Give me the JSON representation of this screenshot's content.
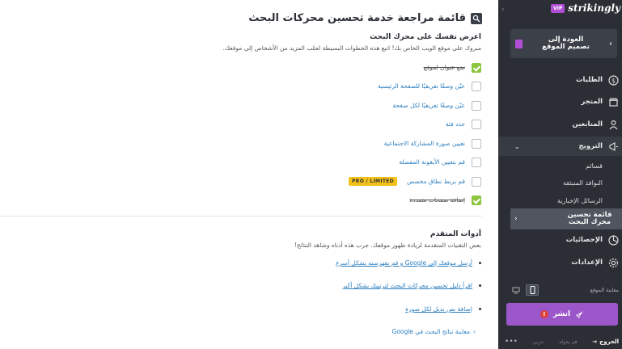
{
  "main": {
    "title": "قائمة مراجعة خدمة تحسين محركات البحث",
    "intro": {
      "heading": "اعرض نفسك على محرك البحث",
      "desc": "مبروك على موقع الويب الخاص بك! اتبع هذه الخطوات البسيطة لجلب المزيد من الأشخاص إلى موقعك."
    },
    "todos": [
      {
        "label": "ضع عنوان لموقع",
        "done": true
      },
      {
        "label": "عيّن وصفًا تعريفيًا للصفحة الرئيسية",
        "done": false
      },
      {
        "label": "عيّن وصفًا تعريفيًا لكل صفحة",
        "done": false
      },
      {
        "label": "حدد فئة",
        "done": false
      },
      {
        "label": "تعيين صورة المشاركة الاجتماعية",
        "done": false
      },
      {
        "label": "قم بتعيين الأيقونة المفضلة",
        "done": false
      },
      {
        "label": "قم بربط نطاق مخصص",
        "done": false,
        "badge": "PRO / LIMITED"
      },
      {
        "label": "إضافة صفحات متعددة",
        "done": true
      }
    ],
    "advanced": {
      "heading": "أدوات المتقدم",
      "desc": "بعض التقنيات المتقدمة لزيادة ظهور موقعك. جرب هذه أدناه وشاهد النتائج!",
      "links": [
        "أرسل موقعك إلى Google و قم بفهرسته بشكل أسرع",
        "اقرأ دليل تحسين محركات البحث لترتيبك بشكل أكبر",
        "إضافة نص بديل لكل صورة"
      ],
      "preview_link": "معاينة نتائج البحث في Google"
    }
  },
  "sidebar": {
    "vip": "VIP",
    "logo": "strikingly",
    "back": "العودة إلى تصميم الموقع",
    "nav": [
      {
        "label": "الطلبات",
        "icon": "dollar-icon"
      },
      {
        "label": "المتجر",
        "icon": "store-icon"
      },
      {
        "label": "المتابعين",
        "icon": "users-icon"
      },
      {
        "label": "الترويج",
        "icon": "megaphone-icon"
      }
    ],
    "sub": [
      "قسائم",
      "النوافذ المنبثقة",
      "الرسائل الإخبارية",
      "قائمة تحسين محرك البحث"
    ],
    "nav2": [
      {
        "label": "الإحصائيات",
        "icon": "stats-icon"
      },
      {
        "label": "الإعدادات",
        "icon": "gear-icon"
      }
    ],
    "preview_label": "معاينة الموقع",
    "publish": "انشر",
    "footer": {
      "exit": "الخروج",
      "tour": "قم بجولة",
      "lang": "عربي",
      "more": "•••"
    },
    "colors": {
      "accent": "#9b57c9",
      "vip": "#b04fd6",
      "check": "#8cc63f",
      "pro_badge": "#f2c21b"
    }
  }
}
